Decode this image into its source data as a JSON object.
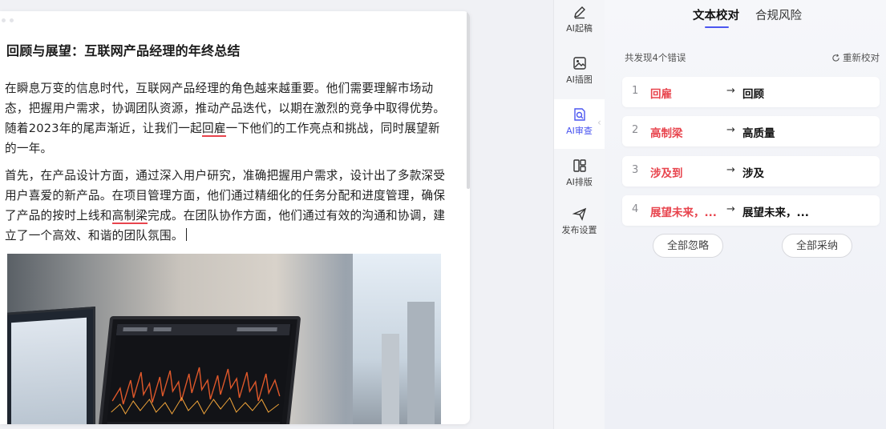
{
  "editor": {
    "title": "回顾与展望：互联网产品经理的年终总结",
    "p1": {
      "before": "在瞬息万变的信息时代，互联网产品经理的角色越来越重要。他们需要理解市场动态，把握用户需求，协调团队资源，推动产品迭代，以期在激烈的竞争中取得优势。随着2023年的尾声渐近，让我们一起",
      "error": "回雇",
      "after": "一下他们的工作亮点和挑战，同时展望新的一年。"
    },
    "p2": {
      "before": "首先，在产品设计方面，通过深入用户研究，准确把握用户需求，设计出了多款深受用户喜爱的新产品。在项目管理方面，他们通过精细化的任务分配和进度管理，确保了产品的按时上线和",
      "error": "高制梁",
      "after": "完成。在团队协作方面，他们通过有效的沟通和协调，建立了一个高效、和谐的团队氛围。"
    },
    "image": {
      "icon": "laptop-chart-photo"
    }
  },
  "rail": {
    "items": [
      {
        "label": "AI起稿",
        "icon": "pen-icon"
      },
      {
        "label": "AI插图",
        "icon": "image-icon"
      },
      {
        "label": "AI审查",
        "icon": "review-icon"
      },
      {
        "label": "AI排版",
        "icon": "layout-icon"
      },
      {
        "label": "发布设置",
        "icon": "send-icon"
      }
    ],
    "active_index": 2
  },
  "panel": {
    "tabs": [
      "文本校对",
      "合规风险"
    ],
    "active_tab": 0,
    "summary": "共发现4个错误",
    "recheck": "重新校对",
    "errors": [
      {
        "num": "1",
        "wrong": "回雇",
        "arrow": "→",
        "right": "回顾"
      },
      {
        "num": "2",
        "wrong": "高制梁",
        "arrow": "→",
        "right": "高质量"
      },
      {
        "num": "3",
        "wrong": "涉及到",
        "arrow": "→",
        "right": "涉及"
      },
      {
        "num": "4",
        "wrong": "展望未来，...",
        "arrow": "→",
        "right": "展望未来，..."
      }
    ],
    "ignore_all": "全部忽略",
    "adopt_all": "全部采纳"
  },
  "colors": {
    "accent": "#4b56f0",
    "error": "#e8444d"
  }
}
